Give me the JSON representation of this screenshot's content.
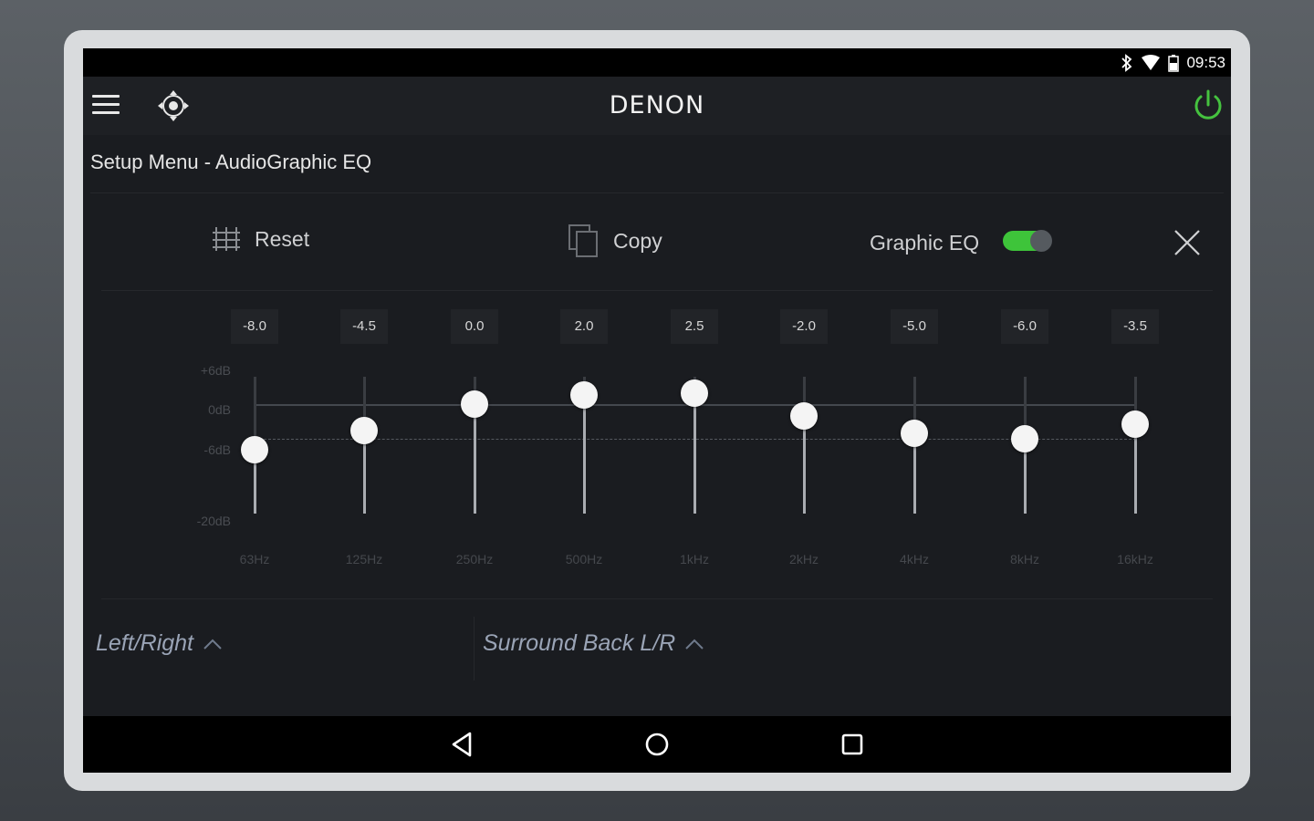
{
  "status": {
    "time": "09:53"
  },
  "app": {
    "brand": "DENON",
    "page_title": "Setup Menu - AudioGraphic EQ"
  },
  "toolbar": {
    "reset_label": "Reset",
    "copy_label": "Copy",
    "geq_label": "Graphic EQ",
    "geq_enabled": true
  },
  "eq": {
    "db_labels": [
      "+6dB",
      "0dB",
      "-6dB",
      "-20dB"
    ],
    "bands": [
      {
        "freq": "63Hz",
        "value": "-8.0",
        "db": -8.0
      },
      {
        "freq": "125Hz",
        "value": "-4.5",
        "db": -4.5
      },
      {
        "freq": "250Hz",
        "value": "0.0",
        "db": 0.0
      },
      {
        "freq": "500Hz",
        "value": "2.0",
        "db": 2.0
      },
      {
        "freq": "1kHz",
        "value": "2.5",
        "db": 2.5
      },
      {
        "freq": "2kHz",
        "value": "-2.0",
        "db": -2.0
      },
      {
        "freq": "4kHz",
        "value": "-5.0",
        "db": -5.0
      },
      {
        "freq": "8kHz",
        "value": "-6.0",
        "db": -6.0
      },
      {
        "freq": "16kHz",
        "value": "-3.5",
        "db": -3.5
      }
    ]
  },
  "channels": {
    "left_right": "Left/Right",
    "surround_back": "Surround Back L/R"
  },
  "colors": {
    "accent_green": "#3ec43a",
    "power_green": "#45c23f"
  },
  "icons": [
    "menu-icon",
    "move-icon",
    "power-icon",
    "bluetooth-icon",
    "wifi-icon",
    "battery-icon",
    "reset-icon",
    "copy-icon",
    "close-icon",
    "chevron-up-icon",
    "back-icon",
    "home-icon",
    "recents-icon"
  ]
}
